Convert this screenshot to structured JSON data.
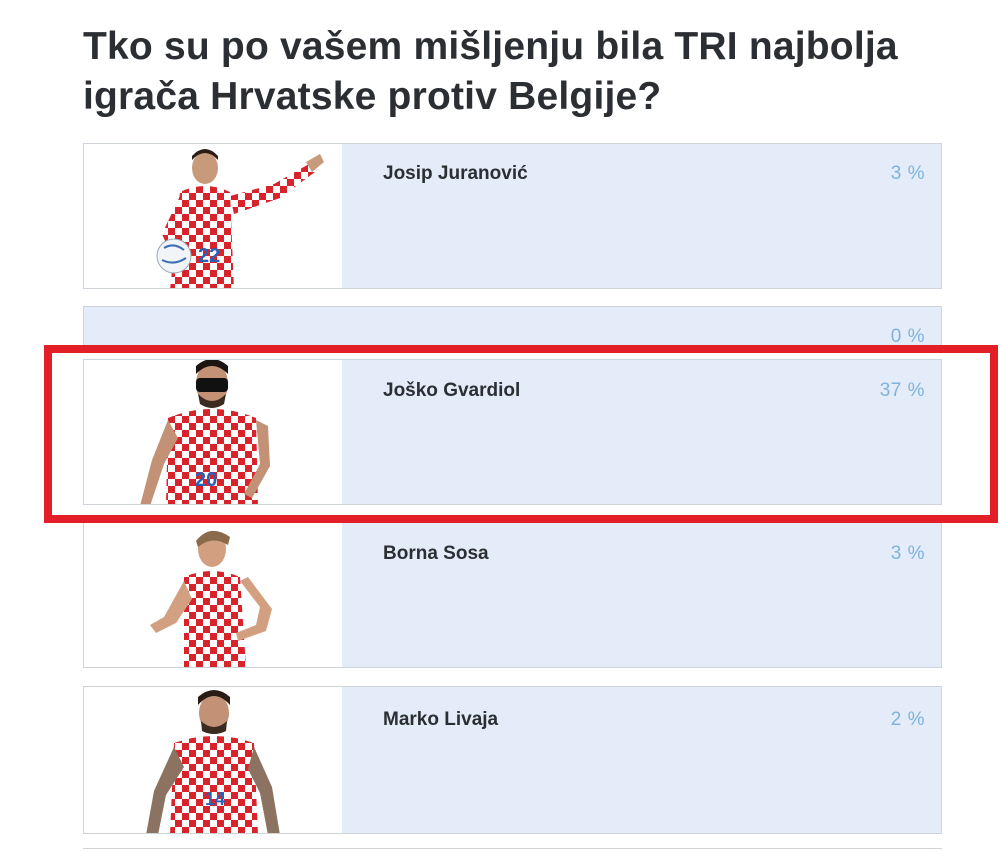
{
  "poll": {
    "title": "Tko su po vašem mišljenju bila TRI najbolja igrača Hrvatske protiv Belgije?",
    "options": [
      {
        "name": "Josip Juranović",
        "percent": "3 %",
        "jersey_number": "22"
      },
      {
        "name": "",
        "percent": "0 %"
      },
      {
        "name": "Joško Gvardiol",
        "percent": "37 %",
        "jersey_number": "20"
      },
      {
        "name": "Borna Sosa",
        "percent": "3 %"
      },
      {
        "name": "Marko Livaja",
        "percent": "2 %",
        "jersey_number": "14"
      }
    ]
  },
  "colors": {
    "card_background": "#e3ecf8",
    "percent_text": "#7fb3dc",
    "highlight_border": "#e31e26",
    "jersey_red": "#d8232a"
  },
  "icons": [
    "player-photo-juranovic",
    "player-photo-gvardiol",
    "player-photo-sosa",
    "player-photo-livaja"
  ]
}
